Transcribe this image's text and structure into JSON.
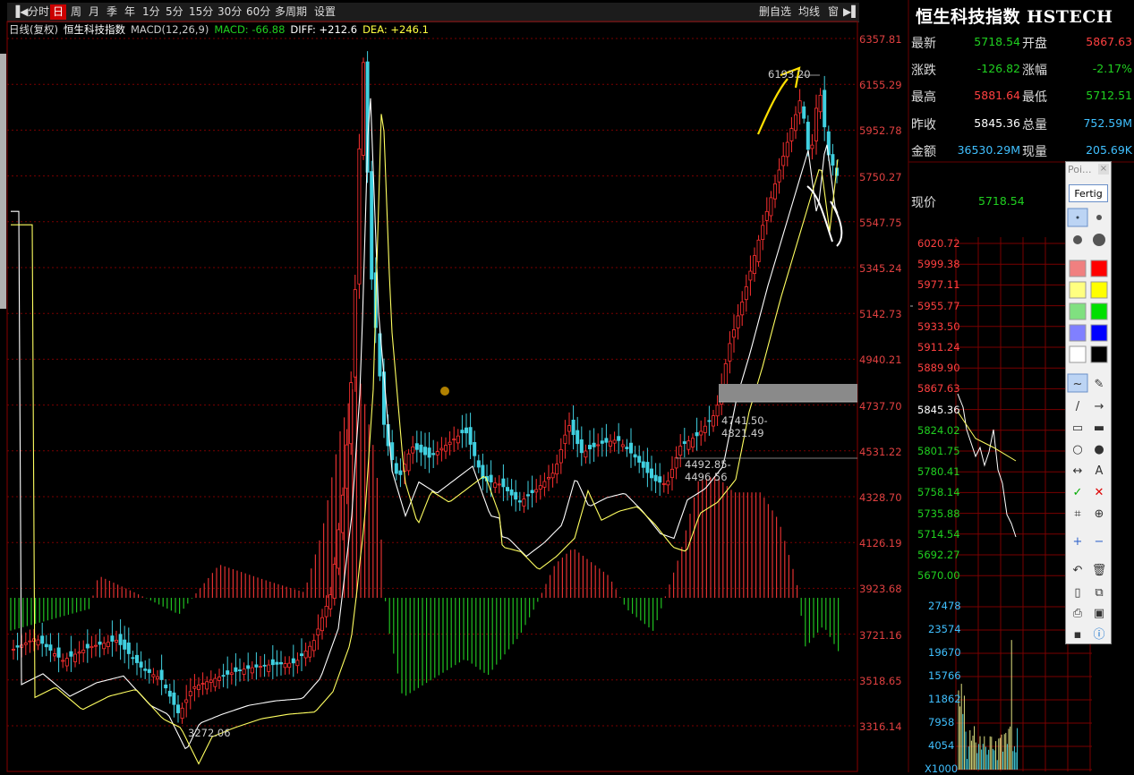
{
  "toolbar": {
    "periods": [
      "分时",
      "日",
      "周",
      "月",
      "季",
      "年",
      "1分",
      "5分",
      "15分",
      "30分",
      "60分",
      "多周期",
      "设置"
    ],
    "active": "日",
    "right": [
      "删自选",
      "均线",
      "窗"
    ]
  },
  "legend": {
    "period": "日线(复权)",
    "name": "恒生科技指数",
    "macd_params": "MACD(12,26,9)",
    "macd": "MACD: -66.88",
    "diff": "DIFF: +212.6",
    "dea": "DEA: +246.1"
  },
  "yaxis": [
    "6357.81",
    "6155.29",
    "5952.78",
    "5750.27",
    "5547.75",
    "5345.24",
    "5142.73",
    "4940.21",
    "4737.70",
    "4531.22",
    "4328.70",
    "4126.19",
    "3923.68",
    "3721.16",
    "3518.65",
    "3316.14"
  ],
  "annotations": {
    "high": "6193.20",
    "zone1": "4741.50-4821.49",
    "zone2": "4492.85-4496.56",
    "low": "3272.06"
  },
  "quote": {
    "title": "恒生科技指数 HSTECH",
    "rows": [
      {
        "l1": "最新",
        "v1": "5718.54",
        "c1": "#20d020",
        "l2": "开盘",
        "v2": "5867.63",
        "c2": "#ff4040"
      },
      {
        "l1": "涨跌",
        "v1": "-126.82",
        "c1": "#20d020",
        "l2": "涨幅",
        "v2": "-2.17%",
        "c2": "#20d020"
      },
      {
        "l1": "最高",
        "v1": "5881.64",
        "c1": "#ff4040",
        "l2": "最低",
        "v2": "5712.51",
        "c2": "#20d020"
      },
      {
        "l1": "昨收",
        "v1": "5845.36",
        "c1": "#ffffff",
        "l2": "总量",
        "v2": "752.59M",
        "c2": "#40c0ff"
      },
      {
        "l1": "金额",
        "v1": "36530.29M",
        "c1": "#40c0ff",
        "l2": "现量",
        "v2": "205.69K",
        "c2": "#40c0ff"
      }
    ],
    "xianjia_label": "现价",
    "xianjia_value": "5718.54"
  },
  "mini": {
    "prices": [
      "6020.72",
      "5999.38",
      "5977.11",
      "5955.77",
      "5933.50",
      "5911.24",
      "5889.90",
      "5867.63",
      "5845.36",
      "5824.02",
      "5801.75",
      "5780.41",
      "5758.14",
      "5735.88",
      "5714.54",
      "5692.27",
      "5670.00"
    ],
    "volumes": [
      "27478",
      "23574",
      "19670",
      "15766",
      "11862",
      "7958",
      "4054",
      "X1000"
    ]
  },
  "tools": {
    "header": "Poi...",
    "fertig": "Fertig"
  },
  "colors": {
    "up": "#ff3030",
    "down": "#40d0e0",
    "grid": "#7a0000",
    "macd_up": "#e03030",
    "macd_down": "#20c020"
  }
}
